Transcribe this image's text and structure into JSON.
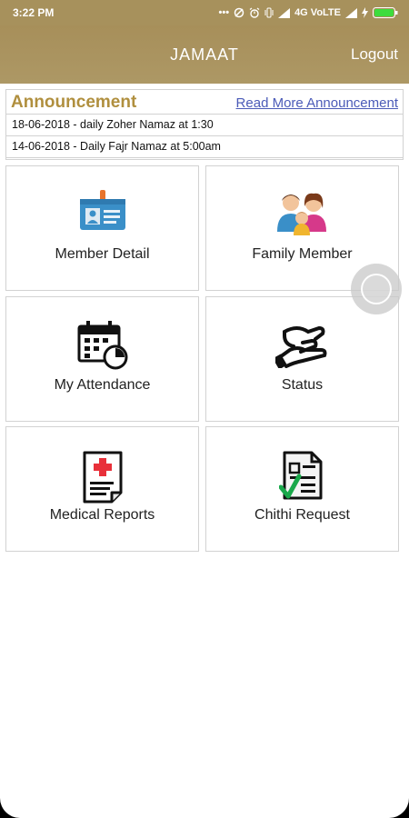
{
  "status_bar": {
    "time": "3:22 PM",
    "network": "4G VoLTE",
    "icons": [
      "more-dots-icon",
      "sync-icon",
      "alarm-icon",
      "vibrate-icon",
      "signal-icon",
      "signal-icon",
      "charging-icon",
      "battery-icon"
    ]
  },
  "header": {
    "title": "JAMAAT",
    "logout_label": "Logout",
    "color": "#a7915c"
  },
  "announcement": {
    "title": "Announcement",
    "read_more": "Read More Announcement",
    "items": [
      "18-06-2018 - daily Zoher Namaz at 1:30",
      "14-06-2018 - Daily Fajr Namaz at 5:00am"
    ]
  },
  "menu": [
    {
      "label": "Member Detail",
      "icon": "id-card-icon"
    },
    {
      "label": "Family Member",
      "icon": "family-icon"
    },
    {
      "label": "My Attendance",
      "icon": "calendar-clock-icon"
    },
    {
      "label": "Status",
      "icon": "hand-money-icon"
    },
    {
      "label": "Medical Reports",
      "icon": "medical-report-icon"
    },
    {
      "label": "Chithi Request",
      "icon": "document-check-icon"
    }
  ]
}
